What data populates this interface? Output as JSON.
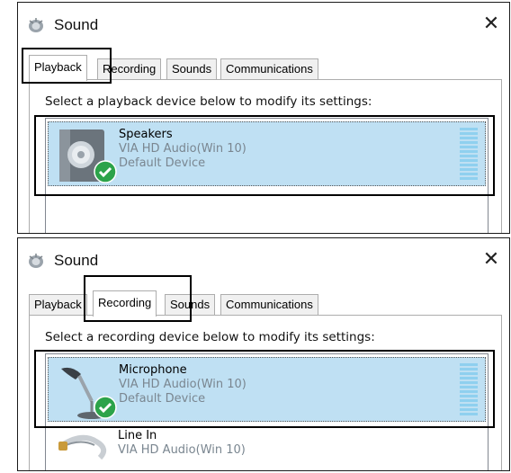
{
  "panels": [
    {
      "window_title": "Sound",
      "close_glyph": "✕",
      "tabs": [
        {
          "label": "Playback",
          "active": true
        },
        {
          "label": "Recording",
          "active": false
        },
        {
          "label": "Sounds",
          "active": false
        },
        {
          "label": "Communications",
          "active": false
        }
      ],
      "instruction": "Select a playback device below to modify its settings:",
      "devices": [
        {
          "name": "Speakers",
          "driver": "VIA HD Audio(Win 10)",
          "status": "Default Device",
          "icon": "speaker-icon",
          "selected": true
        }
      ]
    },
    {
      "window_title": "Sound",
      "close_glyph": "✕",
      "tabs": [
        {
          "label": "Playback",
          "active": false
        },
        {
          "label": "Recording",
          "active": true
        },
        {
          "label": "Sounds",
          "active": false
        },
        {
          "label": "Communications",
          "active": false
        }
      ],
      "instruction": "Select a recording device below to modify its settings:",
      "devices": [
        {
          "name": "Microphone",
          "driver": "VIA HD Audio(Win 10)",
          "status": "Default Device",
          "icon": "microphone-icon",
          "selected": true
        },
        {
          "name": "Line In",
          "driver": "VIA HD Audio(Win 10)",
          "status": "",
          "icon": "line-in-cable-icon",
          "selected": false
        }
      ]
    }
  ],
  "colors": {
    "selection": "#bfe0f3",
    "meter": "#8fd0ef",
    "default_check": "#2ca34a",
    "secondary_text": "#7a8690"
  }
}
